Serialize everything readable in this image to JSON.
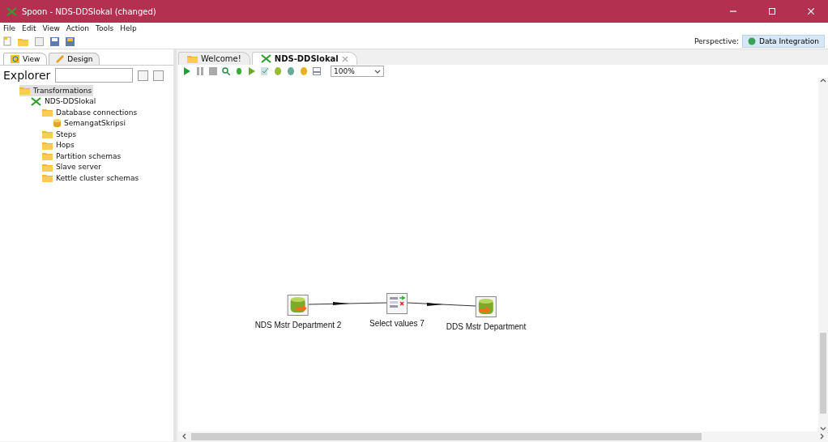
{
  "window": {
    "title": "Spoon - NDS-DDSlokal (changed)"
  },
  "menu": [
    "File",
    "Edit",
    "View",
    "Action",
    "Tools",
    "Help"
  ],
  "perspective": {
    "label": "Perspective:",
    "button": "Data Integration"
  },
  "left_tabs": [
    {
      "label": "View",
      "selected": true
    },
    {
      "label": "Design",
      "selected": false
    }
  ],
  "explorer": {
    "label": "Explorer"
  },
  "tree": [
    {
      "label": "Transformations",
      "kind": "folder",
      "selected": true,
      "children": [
        {
          "label": "NDS-DDSlokal",
          "kind": "transformation",
          "selected": false,
          "children": [
            {
              "label": "Database connections",
              "kind": "folder",
              "selected": false,
              "children": [
                {
                  "label": "SemangatSkripsi",
                  "kind": "database",
                  "selected": false
                }
              ]
            },
            {
              "label": "Steps",
              "kind": "folder",
              "selected": false
            },
            {
              "label": "Hops",
              "kind": "folder",
              "selected": false
            },
            {
              "label": "Partition schemas",
              "kind": "folder",
              "selected": false
            },
            {
              "label": "Slave server",
              "kind": "folder",
              "selected": false
            },
            {
              "label": "Kettle cluster schemas",
              "kind": "folder",
              "selected": false
            }
          ]
        }
      ]
    }
  ],
  "editor_tabs": [
    {
      "label": "Welcome!",
      "kind": "welcome",
      "selected": false
    },
    {
      "label": "NDS-DDSlokal",
      "kind": "transformation",
      "selected": true
    }
  ],
  "zoom": {
    "value": "100%"
  },
  "steps": [
    {
      "label": "NDS Mstr Department 2",
      "kind": "input"
    },
    {
      "label": "Select values 7",
      "kind": "select"
    },
    {
      "label": "DDS Mstr Department",
      "kind": "output"
    }
  ]
}
